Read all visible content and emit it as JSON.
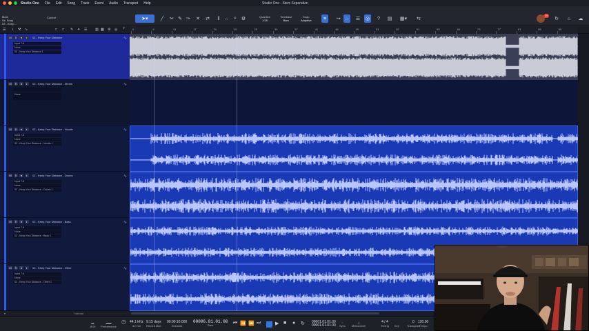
{
  "menubar": {
    "app": "Studio One",
    "items": [
      "File",
      "Edit",
      "Song",
      "Track",
      "Event",
      "Audio",
      "Transport",
      "Help"
    ],
    "window_title": "Studio One - Stem Separation"
  },
  "toolbar": {
    "device_lines": [
      "Mute",
      "Vir. Snap",
      "02 - Keep..."
    ],
    "control_label": "Control",
    "quantize": {
      "label": "Quantize",
      "value": "1/16"
    },
    "timebase": {
      "label": "Timebase",
      "value": "Bars"
    },
    "snap": {
      "label": "Snap",
      "value": "Adaptive"
    },
    "badge": "19"
  },
  "ruler": {
    "numbers": [
      "5",
      "9",
      "13",
      "17",
      "21",
      "25",
      "29",
      "33",
      "37",
      "41",
      "45",
      "49",
      "53",
      "57",
      "61",
      "65",
      "69",
      "73",
      "77",
      "81",
      "85",
      "89"
    ]
  },
  "tracks": [
    {
      "name": "02 - Keep Your Distance",
      "input": "Input 7-8",
      "output": "None",
      "extra": "03 - Keep Your Distance 1",
      "state": "sel",
      "type": "stereo"
    },
    {
      "name": "02 - Keep Your Distance - Stems",
      "input": "",
      "output": "None",
      "extra": "",
      "state": "dim",
      "type": "folder"
    },
    {
      "name": "02 - Keep Your Distance - Vocals",
      "input": "Input 7-8",
      "output": "None",
      "extra": "02 - Keep Your Distance - Vocals 1",
      "state": "norm",
      "type": "stereo"
    },
    {
      "name": "02 - Keep Your Distance - Drums",
      "input": "Input 7-8",
      "output": "None",
      "extra": "02 - Keep Your Distance - Drums 1",
      "state": "norm",
      "type": "stereo"
    },
    {
      "name": "02 - Keep Your Distance - Bass",
      "input": "Input 7-8",
      "output": "None",
      "extra": "02 - Keep Your Distance - Bass 1",
      "state": "norm",
      "type": "stereo"
    },
    {
      "name": "02 - Keep Your Distance - Other",
      "input": "Input 7-8",
      "output": "None",
      "extra": "02 - Keep Your Distance - Other 1",
      "state": "norm",
      "type": "stereo"
    }
  ],
  "footer": {
    "zoom": "Normal"
  },
  "transport": {
    "midi": "MIDI",
    "performance": "Performance",
    "sample_rate": "44.1 kHz",
    "latency": "3.0 ms",
    "record_days": "9:15 days",
    "record_label": "Record Max",
    "seconds": "00:00:10.000",
    "seconds_label": "Seconds",
    "position": "00006.01.01.00",
    "bars_label": "Bars",
    "loop_start": "00001.01.01.00",
    "loop_end": "00001.01.01.00",
    "sync": "Sync",
    "metronome": "Metronome",
    "timing_sig": "4 / 4",
    "timing_label": "Timing",
    "key": "Key",
    "transpose": "0",
    "transpose_label": "Transpose",
    "tempo": "120.00",
    "tempo_label": "Tempo"
  },
  "colors": {
    "track_blue": "#1a3ab5",
    "selected_track": "#1f2a9a",
    "accent": "#3a6fd6"
  }
}
